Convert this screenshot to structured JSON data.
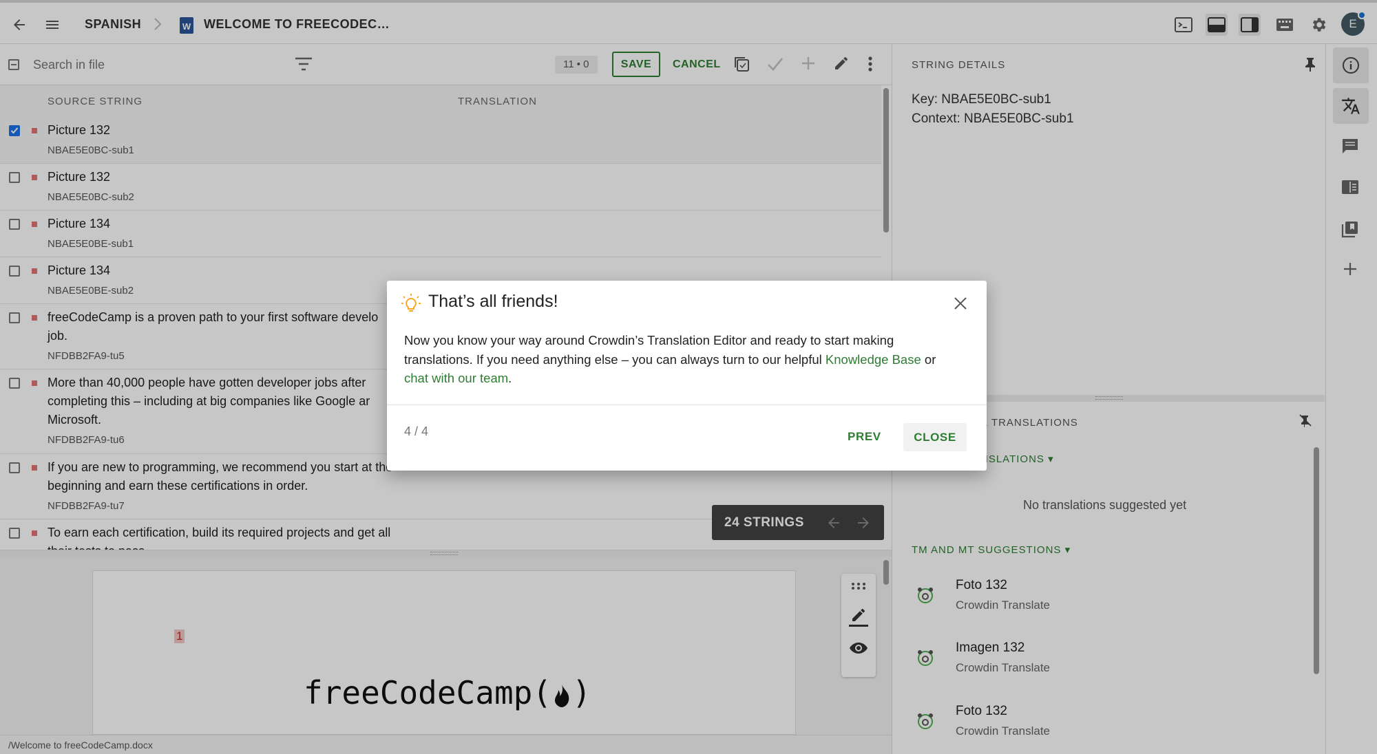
{
  "topbar": {
    "language": "SPANISH",
    "file_title": "WELCOME TO FREECODEC…",
    "avatar_letter": "E"
  },
  "toolbar": {
    "search_placeholder": "Search in file",
    "counter": "11 • 0",
    "save_label": "SAVE",
    "cancel_label": "CANCEL"
  },
  "columns": {
    "source": "SOURCE STRING",
    "translation": "TRANSLATION"
  },
  "rows": [
    {
      "text": "Picture 132",
      "key": "NBAE5E0BC-sub1",
      "checked": true
    },
    {
      "text": "Picture 132",
      "key": "NBAE5E0BC-sub2"
    },
    {
      "text": "Picture 134",
      "key": "NBAE5E0BE-sub1"
    },
    {
      "text": "Picture 134",
      "key": "NBAE5E0BE-sub2"
    },
    {
      "text": "freeCodeCamp is a proven path to your first software develo",
      "text2": "job.",
      "key": "NFDBB2FA9-tu5"
    },
    {
      "text": "More than 40,000 people have gotten developer jobs after",
      "text2": "completing this – including at big companies like Google ar",
      "text3": "Microsoft.",
      "key": "NFDBB2FA9-tu6"
    },
    {
      "text": "If you are new to programming, we recommend you start at the",
      "text2": "beginning and earn these certifications in order.",
      "key": "NFDBB2FA9-tu7"
    },
    {
      "text": "To earn each certification, build its required projects and get all",
      "text2": "their tests to pass."
    }
  ],
  "strings_badge": "24 STRINGS",
  "preview": {
    "marker": "1",
    "logo_text": "freeCodeCamp("
  },
  "footer_path": "/Welcome to freeCodeCamp.docx",
  "details": {
    "header": "STRING DETAILS",
    "key_line": "Key: NBAE5E0BC-sub1",
    "context_line": "Context: NBAE5E0BC-sub1"
  },
  "suggestions": {
    "header": "COMMENTS & TRANSLATIONS",
    "header_visible": "& TRANSLATIONS",
    "translations_label": "NSLATIONS",
    "empty": "No translations suggested yet",
    "tm_label": "TM AND MT SUGGESTIONS",
    "items": [
      {
        "text": "Foto 132",
        "source": "Crowdin Translate"
      },
      {
        "text": "Imagen 132",
        "source": "Crowdin Translate"
      },
      {
        "text": "Foto 132",
        "source": "Crowdin Translate"
      }
    ]
  },
  "dialog": {
    "title": "That’s all friends!",
    "body_1": "Now you know your way around Crowdin’s Translation Editor and ready to start making",
    "body_2a": "translations. If you need anything else – you can always turn to our helpful ",
    "link_kb": "Knowledge Base",
    "body_2b": " or",
    "link_chat": "chat with our team",
    "body_3": ".",
    "step": "4 / 4",
    "prev_label": "PREV",
    "close_label": "CLOSE"
  },
  "colors": {
    "accent": "#2e7d32",
    "checkbox": "#1a73e8",
    "flag": "#e57373"
  }
}
